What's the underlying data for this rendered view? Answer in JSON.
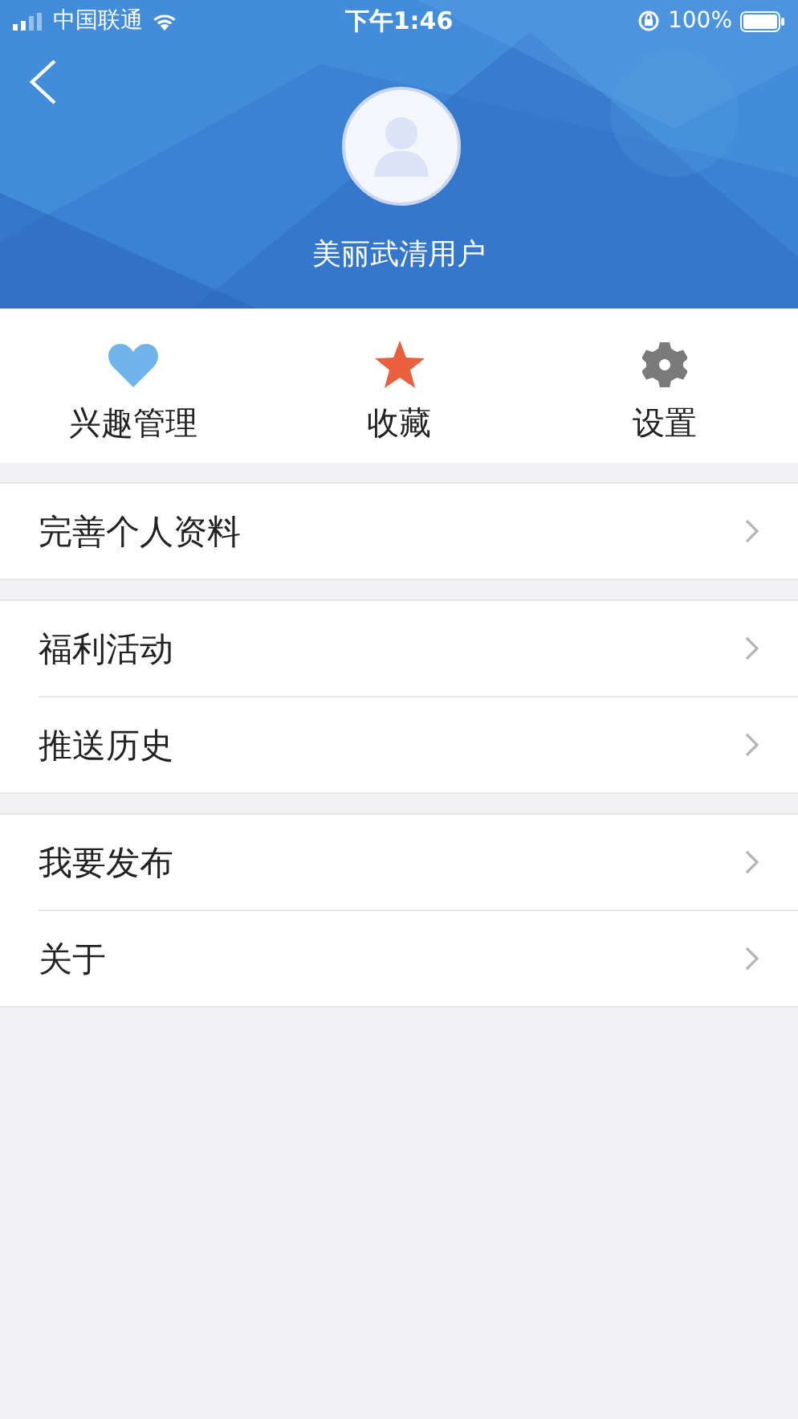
{
  "status_bar": {
    "carrier": "中国联通",
    "time": "下午1:46",
    "battery": "100%"
  },
  "profile": {
    "name": "美丽武清用户"
  },
  "quick_actions": [
    {
      "kind": "heart",
      "label": "兴趣管理"
    },
    {
      "kind": "star",
      "label": "收藏"
    },
    {
      "kind": "gear",
      "label": "设置"
    }
  ],
  "menu_groups": [
    {
      "items": [
        {
          "label": "完善个人资料"
        }
      ]
    },
    {
      "items": [
        {
          "label": "福利活动"
        },
        {
          "label": "推送历史"
        }
      ]
    },
    {
      "items": [
        {
          "label": "我要发布"
        },
        {
          "label": "关于"
        }
      ]
    }
  ]
}
